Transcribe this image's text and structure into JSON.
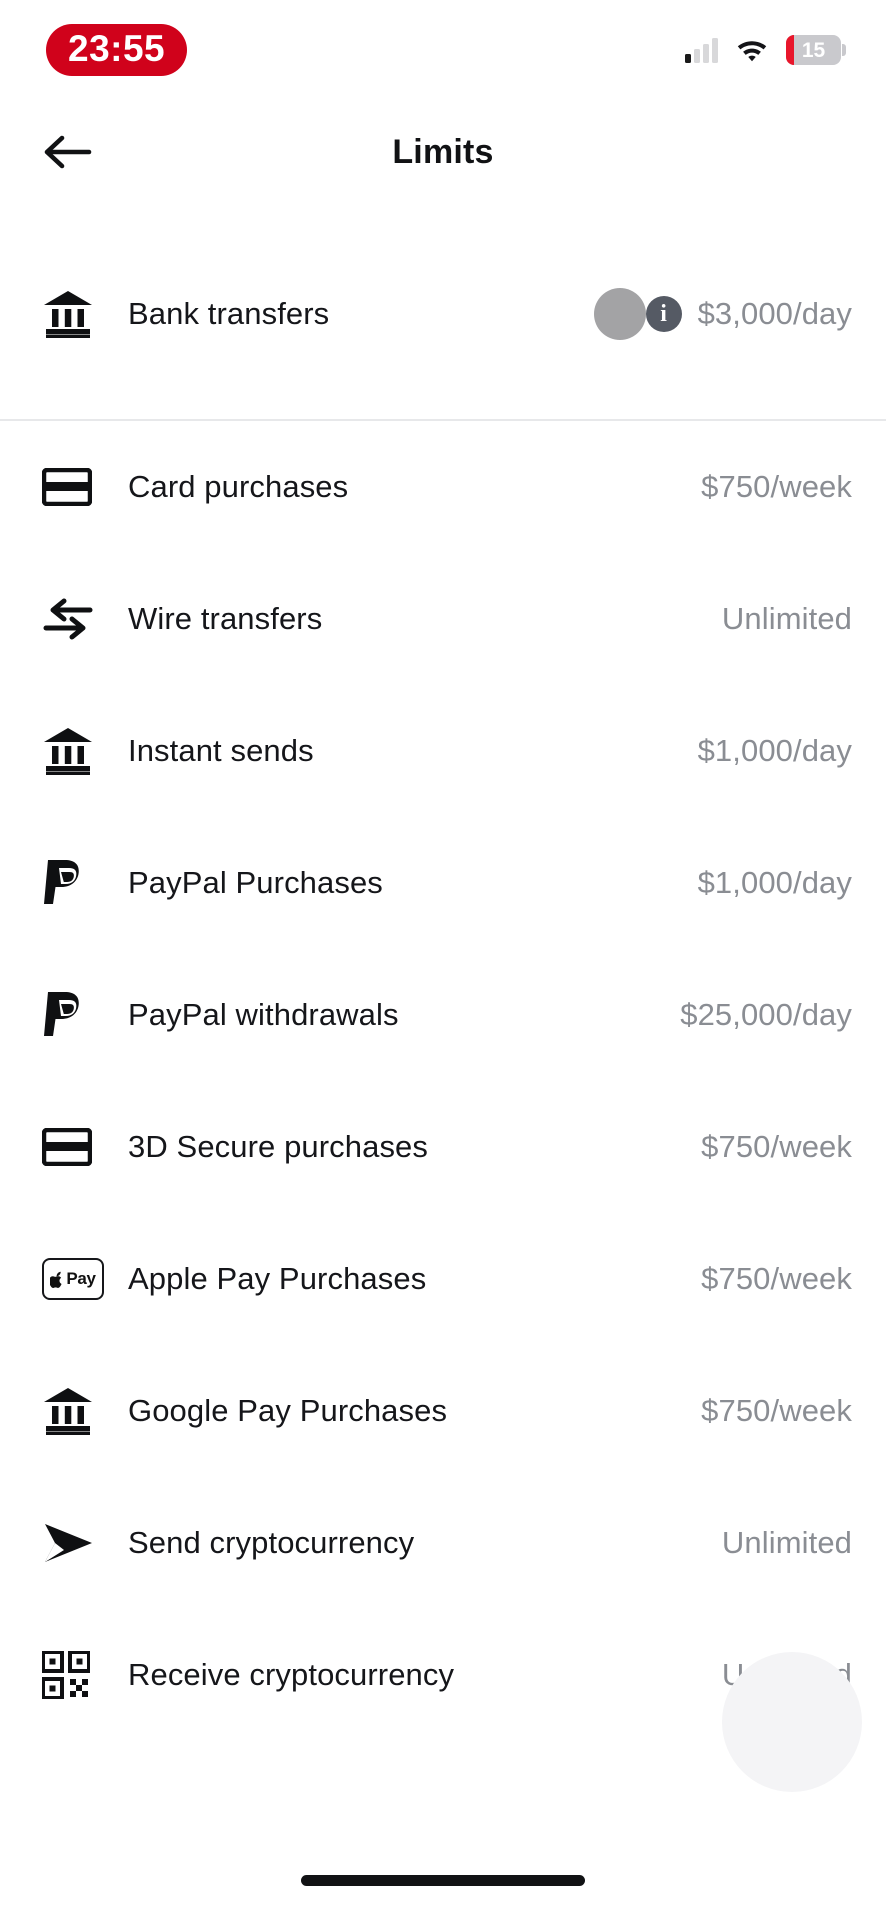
{
  "status_bar": {
    "time": "23:55",
    "time_badge_color": "#d0021b",
    "signal_icon": "cellular-signal-icon",
    "signal_bars_filled": 1,
    "signal_bars_total": 4,
    "wifi_icon": "wifi-icon",
    "battery_icon": "battery-icon",
    "battery_level": "15",
    "battery_low_color": "#e8162b"
  },
  "header": {
    "back_icon": "back-arrow-icon",
    "title": "Limits"
  },
  "primary_row": {
    "icon": "bank-icon",
    "label": "Bank transfers",
    "busy_indicator": "loading-dot-indicator",
    "info_icon": "info-icon",
    "info_glyph": "i",
    "value": "$3,000/day"
  },
  "limits": [
    {
      "icon": "credit-card-icon",
      "label": "Card purchases",
      "value": "$750/week"
    },
    {
      "icon": "swap-arrows-icon",
      "label": "Wire transfers",
      "value": "Unlimited"
    },
    {
      "icon": "bank-icon",
      "label": "Instant sends",
      "value": "$1,000/day"
    },
    {
      "icon": "paypal-icon",
      "label": "PayPal Purchases",
      "value": "$1,000/day"
    },
    {
      "icon": "paypal-icon",
      "label": "PayPal withdrawals",
      "value": "$25,000/day"
    },
    {
      "icon": "credit-card-icon",
      "label": "3D Secure purchases",
      "value": "$750/week"
    },
    {
      "icon": "apple-pay-icon",
      "label": "Apple Pay Purchases",
      "value": "$750/week"
    },
    {
      "icon": "bank-icon",
      "label": "Google Pay Purchases",
      "value": "$750/week"
    },
    {
      "icon": "send-plane-icon",
      "label": "Send cryptocurrency",
      "value": "Unlimited"
    },
    {
      "icon": "qr-code-icon",
      "label": "Receive cryptocurrency",
      "value": "Unlimited"
    }
  ],
  "fab": {
    "name": "floating-action-button",
    "color": "#f4f4f6"
  },
  "home_indicator": {
    "name": "home-indicator-bar"
  },
  "colors": {
    "label_text": "#15161a",
    "value_text": "#8a8d93",
    "divider": "#e7e8ea",
    "icon": "#0f1012"
  }
}
